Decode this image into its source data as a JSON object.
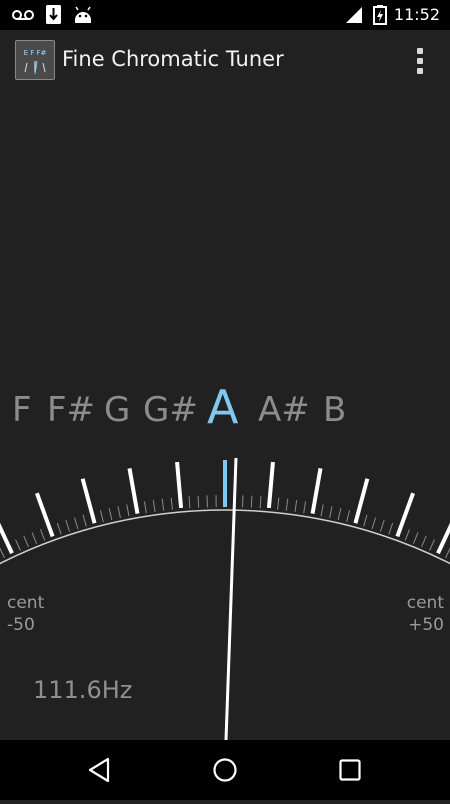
{
  "status_bar": {
    "time": "11:52",
    "icons": [
      "voicemail-icon",
      "download-icon",
      "android-icon",
      "signal-icon",
      "battery-charging-icon"
    ]
  },
  "app_bar": {
    "title": "Fine Chromatic Tuner",
    "icon_text": "E F F#",
    "menu_icon": "overflow-menu-icon"
  },
  "tuner": {
    "notes": [
      "F",
      "F#",
      "G",
      "G#",
      "A",
      "A#",
      "B"
    ],
    "active_note": "A",
    "left_label": {
      "unit": "cent",
      "value": "-50"
    },
    "right_label": {
      "unit": "cent",
      "value": "+50"
    },
    "frequency": "111.6Hz",
    "needle_cents": 1,
    "scale_min": -50,
    "scale_max": 50,
    "colors": {
      "active_note": "#7ec9ee",
      "center_marker": "#7ec9ee",
      "needle": "#ffffff",
      "ticks": "#ffffff"
    }
  },
  "nav_bar": {
    "buttons": [
      "back-icon",
      "home-icon",
      "recents-icon"
    ]
  }
}
